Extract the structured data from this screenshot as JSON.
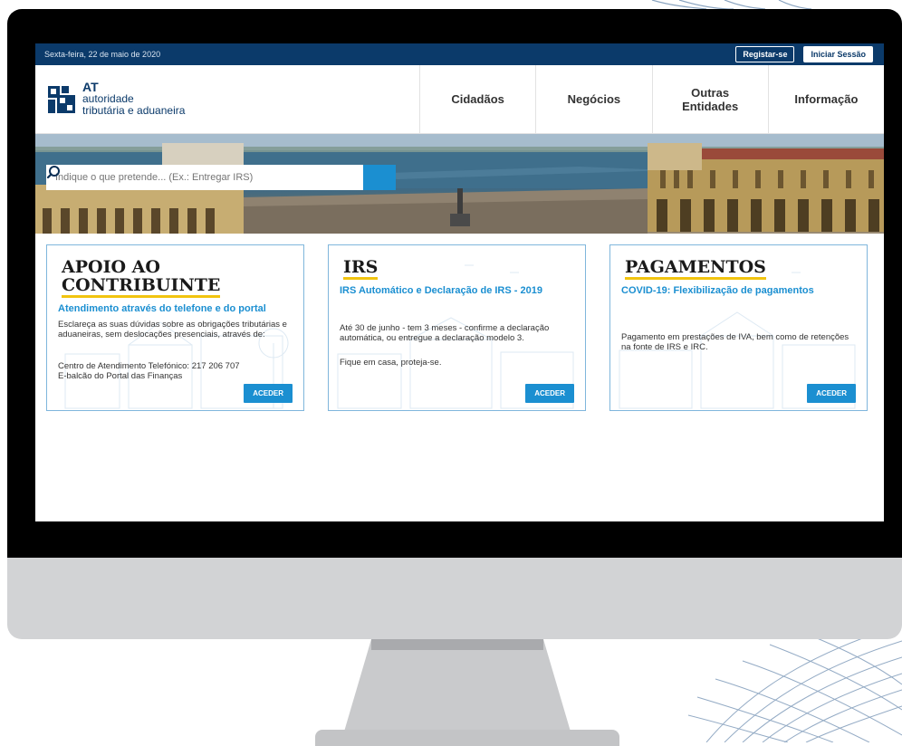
{
  "topbar": {
    "date": "Sexta-feira, 22 de maio de 2020",
    "register_label": "Registar-se",
    "login_label": "Iniciar Sessão"
  },
  "logo": {
    "line1": "AT",
    "line2": "autoridade",
    "line3": "tributária e aduaneira"
  },
  "nav": {
    "items": [
      {
        "label": "Cidadãos"
      },
      {
        "label": "Negócios"
      },
      {
        "line1": "Outras",
        "line2": "Entidades"
      },
      {
        "label": "Informação"
      }
    ]
  },
  "search": {
    "placeholder": "Indique o que pretende... (Ex.: Entregar IRS)"
  },
  "cards": [
    {
      "title_line1": "APOIO AO",
      "title_line2": "CONTRIBUINTE",
      "subtitle": "Atendimento através do telefone e do portal",
      "body1": "Esclareça as suas dúvidas sobre as obrigações tributárias e aduaneiras, sem deslocações presenciais, através de:",
      "body2": "Centro de Atendimento Telefónico: 217 206 707",
      "body3": "E-balcão do Portal das Finanças",
      "button": "ACEDER"
    },
    {
      "title": "IRS",
      "subtitle": "IRS Automático e Declaração de IRS - 2019",
      "body1": "Até 30 de junho - tem 3 meses - confirme a declaração automática, ou entregue a declaração modelo 3.",
      "body2": "Fique em casa, proteja-se.",
      "button": "ACEDER"
    },
    {
      "title": "PAGAMENTOS",
      "subtitle": "COVID-19: Flexibilização de pagamentos",
      "body1": "Pagamento em prestações de IVA, bem como de retenções na fonte de IRS e IRC.",
      "button": "ACEDER"
    }
  ],
  "colors": {
    "brand_navy": "#0b3a6a",
    "accent_blue": "#1b8fd1",
    "title_underline": "#f1c40f",
    "card_border": "#7fb6dc"
  }
}
